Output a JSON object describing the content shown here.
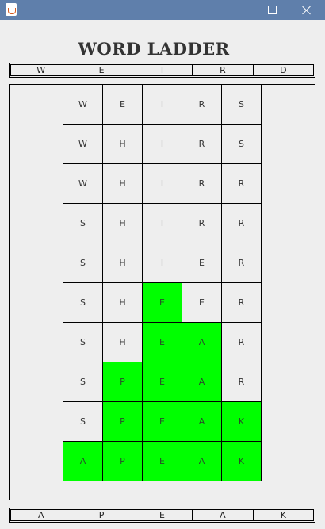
{
  "window": {
    "icon": "java-cup-icon",
    "title": ""
  },
  "game": {
    "title": "WORD LADDER",
    "start_word": [
      "W",
      "E",
      "I",
      "R",
      "D"
    ],
    "target_word": [
      "A",
      "P",
      "E",
      "A",
      "K"
    ],
    "ladder": [
      {
        "letters": [
          "W",
          "E",
          "I",
          "R",
          "S"
        ],
        "matched": [
          false,
          false,
          false,
          false,
          false
        ]
      },
      {
        "letters": [
          "W",
          "H",
          "I",
          "R",
          "S"
        ],
        "matched": [
          false,
          false,
          false,
          false,
          false
        ]
      },
      {
        "letters": [
          "W",
          "H",
          "I",
          "R",
          "R"
        ],
        "matched": [
          false,
          false,
          false,
          false,
          false
        ]
      },
      {
        "letters": [
          "S",
          "H",
          "I",
          "R",
          "R"
        ],
        "matched": [
          false,
          false,
          false,
          false,
          false
        ]
      },
      {
        "letters": [
          "S",
          "H",
          "I",
          "E",
          "R"
        ],
        "matched": [
          false,
          false,
          false,
          false,
          false
        ]
      },
      {
        "letters": [
          "S",
          "H",
          "E",
          "E",
          "R"
        ],
        "matched": [
          false,
          false,
          true,
          false,
          false
        ]
      },
      {
        "letters": [
          "S",
          "H",
          "E",
          "A",
          "R"
        ],
        "matched": [
          false,
          false,
          true,
          true,
          false
        ]
      },
      {
        "letters": [
          "S",
          "P",
          "E",
          "A",
          "R"
        ],
        "matched": [
          false,
          true,
          true,
          true,
          false
        ]
      },
      {
        "letters": [
          "S",
          "P",
          "E",
          "A",
          "K"
        ],
        "matched": [
          false,
          true,
          true,
          true,
          true
        ]
      },
      {
        "letters": [
          "A",
          "P",
          "E",
          "A",
          "K"
        ],
        "matched": [
          true,
          true,
          true,
          true,
          true
        ]
      }
    ]
  },
  "colors": {
    "matched_cell": "#00ff00",
    "cell_background": "#eeeeee",
    "titlebar": "#5f7fab"
  }
}
